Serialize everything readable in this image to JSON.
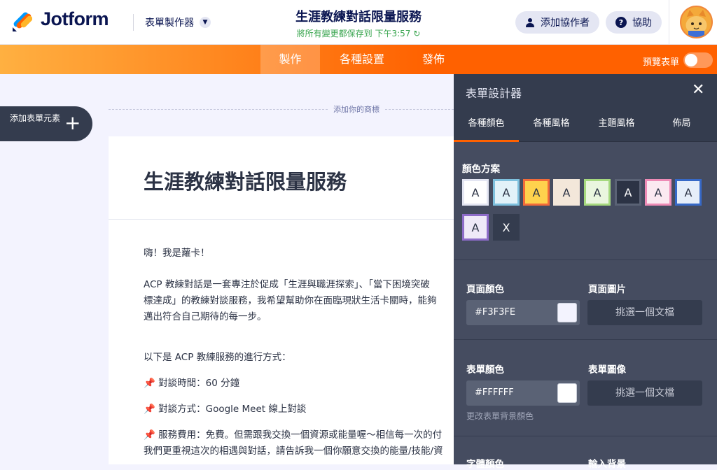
{
  "header": {
    "logo_text": "Jotform",
    "builder_label": "表單製作器",
    "form_title": "生涯教練對話限量服務",
    "saved_status": "將所有變更都保存到 下午3:57",
    "add_collaborator": "添加協作者",
    "help": "協助"
  },
  "nav": {
    "tabs": [
      "製作",
      "各種設置",
      "發佈"
    ],
    "active_tab": "製作",
    "preview_label": "預覽表單",
    "preview_on": false
  },
  "canvas": {
    "add_element": "添加表單元素",
    "add_logo": "添加你的商標",
    "form_heading": "生涯教練對話限量服務",
    "paragraphs": [
      "嗨！我是蘿卡！",
      "ACP 教練對話是一套專注於促成「生涯與職涯探索」、「當下困境突破",
      "標達成」的教練對談服務，我希望幫助你在面臨現狀生活卡關時，能夠",
      "邁出符合自己期待的每一步。",
      "以下是 ACP 教練服務的進行方式：",
      "對談時間：60 分鐘",
      "對談方式：Google Meet 線上對談",
      "服務費用：免費。但需跟我交換一個資源或能量喔～相信每一次的付",
      "我們更重視這次的相遇與對話，請告訴我一個你願意交換的能量/技能/資"
    ]
  },
  "designer": {
    "title": "表單設計器",
    "tabs": [
      "各種顏色",
      "各種風格",
      "主題風格",
      "佈局"
    ],
    "active_tab": "各種顏色",
    "color_scheme_label": "顏色方案",
    "swatches": [
      {
        "label": "A",
        "bg": "#FFFFFF",
        "border": "#E4E6F3",
        "fg": "#2C3345"
      },
      {
        "label": "A",
        "bg": "#E2F2F9",
        "border": "#7FC1DE",
        "fg": "#2C3345"
      },
      {
        "label": "A",
        "bg": "#FFD24D",
        "border": "#F26B3A",
        "fg": "#2C3345"
      },
      {
        "label": "A",
        "bg": "#F3E7DA",
        "border": "#F3E7DA",
        "fg": "#2C3345"
      },
      {
        "label": "A",
        "bg": "#EAF6DF",
        "border": "#A6D97F",
        "fg": "#2C3345"
      },
      {
        "label": "A",
        "bg": "#2C3345",
        "border": "#5A6275",
        "fg": "#FFFFFF"
      },
      {
        "label": "A",
        "bg": "#FBE9F1",
        "border": "#EE8BB6",
        "fg": "#2C3345"
      },
      {
        "label": "A",
        "bg": "#E6EEF9",
        "border": "#3769C7",
        "fg": "#2C3345"
      },
      {
        "label": "A",
        "bg": "#EFE9F8",
        "border": "#8E6CC9",
        "fg": "#2C3345"
      },
      {
        "label": "X",
        "bg": "#343C4E",
        "border": "#343C4E",
        "fg": "#FFFFFF"
      }
    ],
    "page_color_label": "頁面顏色",
    "page_color_value": "#F3F3FE",
    "page_image_label": "頁面圖片",
    "choose_file": "挑選一個文檔",
    "form_color_label": "表單顏色",
    "form_color_value": "#FFFFFF",
    "form_image_label": "表單圖像",
    "form_color_hint": "更改表單背景顏色",
    "font_color_label": "字體顏色",
    "input_bg_label": "輸入背景"
  }
}
